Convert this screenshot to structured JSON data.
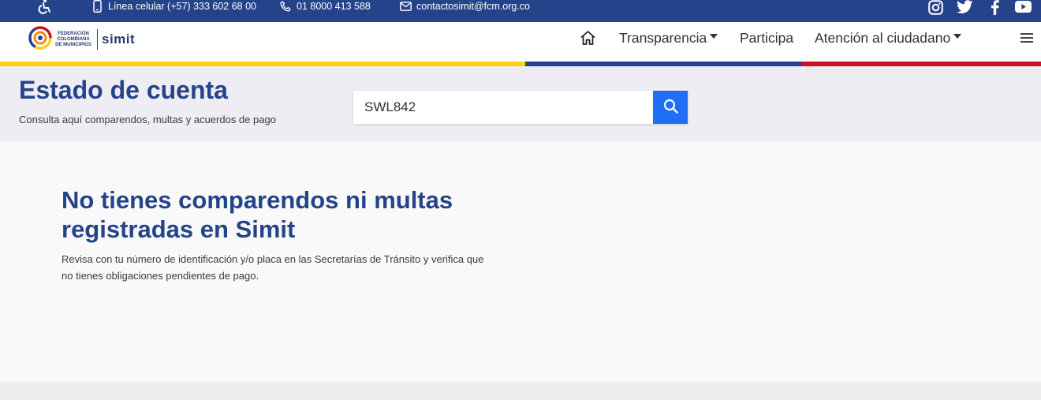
{
  "topbar": {
    "phone_mobile": "Línea celular (+57) 333 602 68 00",
    "phone_line": "01 8000 413 588",
    "email": "contactosimit@fcm.org.co",
    "icons": [
      "accessibility-icon",
      "mobile-phone-icon",
      "phone-icon",
      "mail-icon",
      "instagram-icon",
      "twitter-icon",
      "facebook-icon",
      "youtube-icon"
    ]
  },
  "header": {
    "logo_fcm": "FEDERACIÓN COLOMBIANA DE MUNICIPIOS",
    "logo_simit": "simit",
    "nav": {
      "transparencia": "Transparencia",
      "participa": "Participa",
      "atencion": "Atención al ciudadano"
    }
  },
  "colors": {
    "brand_blue": "#24438a",
    "accent_blue": "#1e6ff5",
    "flag_yellow": "#fcd116",
    "flag_blue": "#24438a",
    "flag_red": "#ce1126"
  },
  "hero": {
    "title": "Estado de cuenta",
    "subtitle": "Consulta aquí comparendos, multas y acuerdos de pago",
    "search_value": "SWL842"
  },
  "result": {
    "title": "No tienes comparendos ni multas registradas en Simit",
    "message": "Revisa con tu número de identificación y/o placa en las Secretarías de Tránsito y verifica que no tienes obligaciones pendientes de pago."
  }
}
